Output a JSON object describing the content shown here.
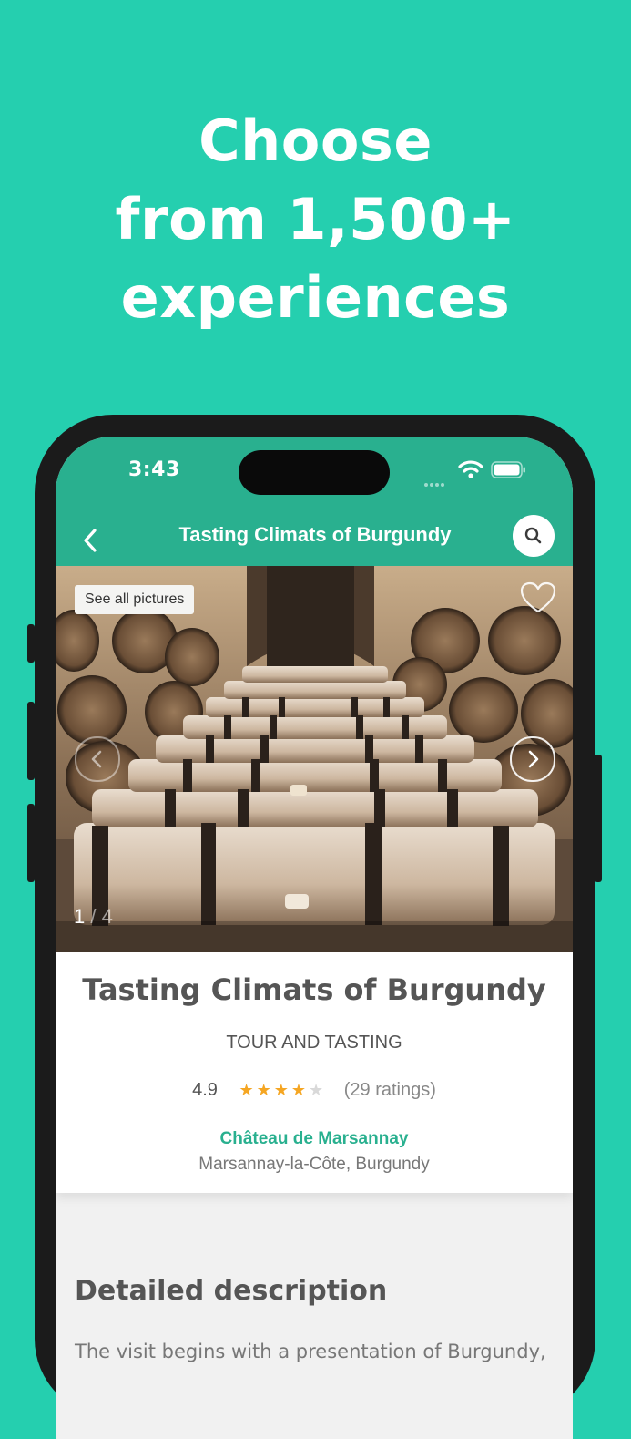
{
  "promo": {
    "line1": "Choose",
    "line2": "from 1,500+",
    "line3": "experiences"
  },
  "status_bar": {
    "time": "3:43",
    "icons": [
      "signal-icon",
      "wifi-icon",
      "battery-icon"
    ]
  },
  "nav": {
    "title": "Tasting Climats of Burgundy",
    "back_icon": "chevron-left-icon",
    "search_icon": "search-icon"
  },
  "gallery": {
    "see_all_label": "See all pictures",
    "current": "1",
    "separator": " / ",
    "total": "4",
    "favorite_icon": "heart-icon"
  },
  "experience": {
    "title": "Tasting Climats of Burgundy",
    "category": "TOUR AND TASTING",
    "rating": "4.9",
    "stars_filled": 4,
    "stars_total": 5,
    "ratings_count": "(29 ratings)",
    "estate": "Château de Marsannay",
    "location": "Marsannay-la-Côte, Burgundy"
  },
  "description": {
    "heading": "Detailed description",
    "text": "The visit begins with a presentation of Burgundy,"
  },
  "colors": {
    "background": "#25cfaf",
    "header": "#29b08f",
    "accent": "#29b08f",
    "star": "#f5a623"
  }
}
